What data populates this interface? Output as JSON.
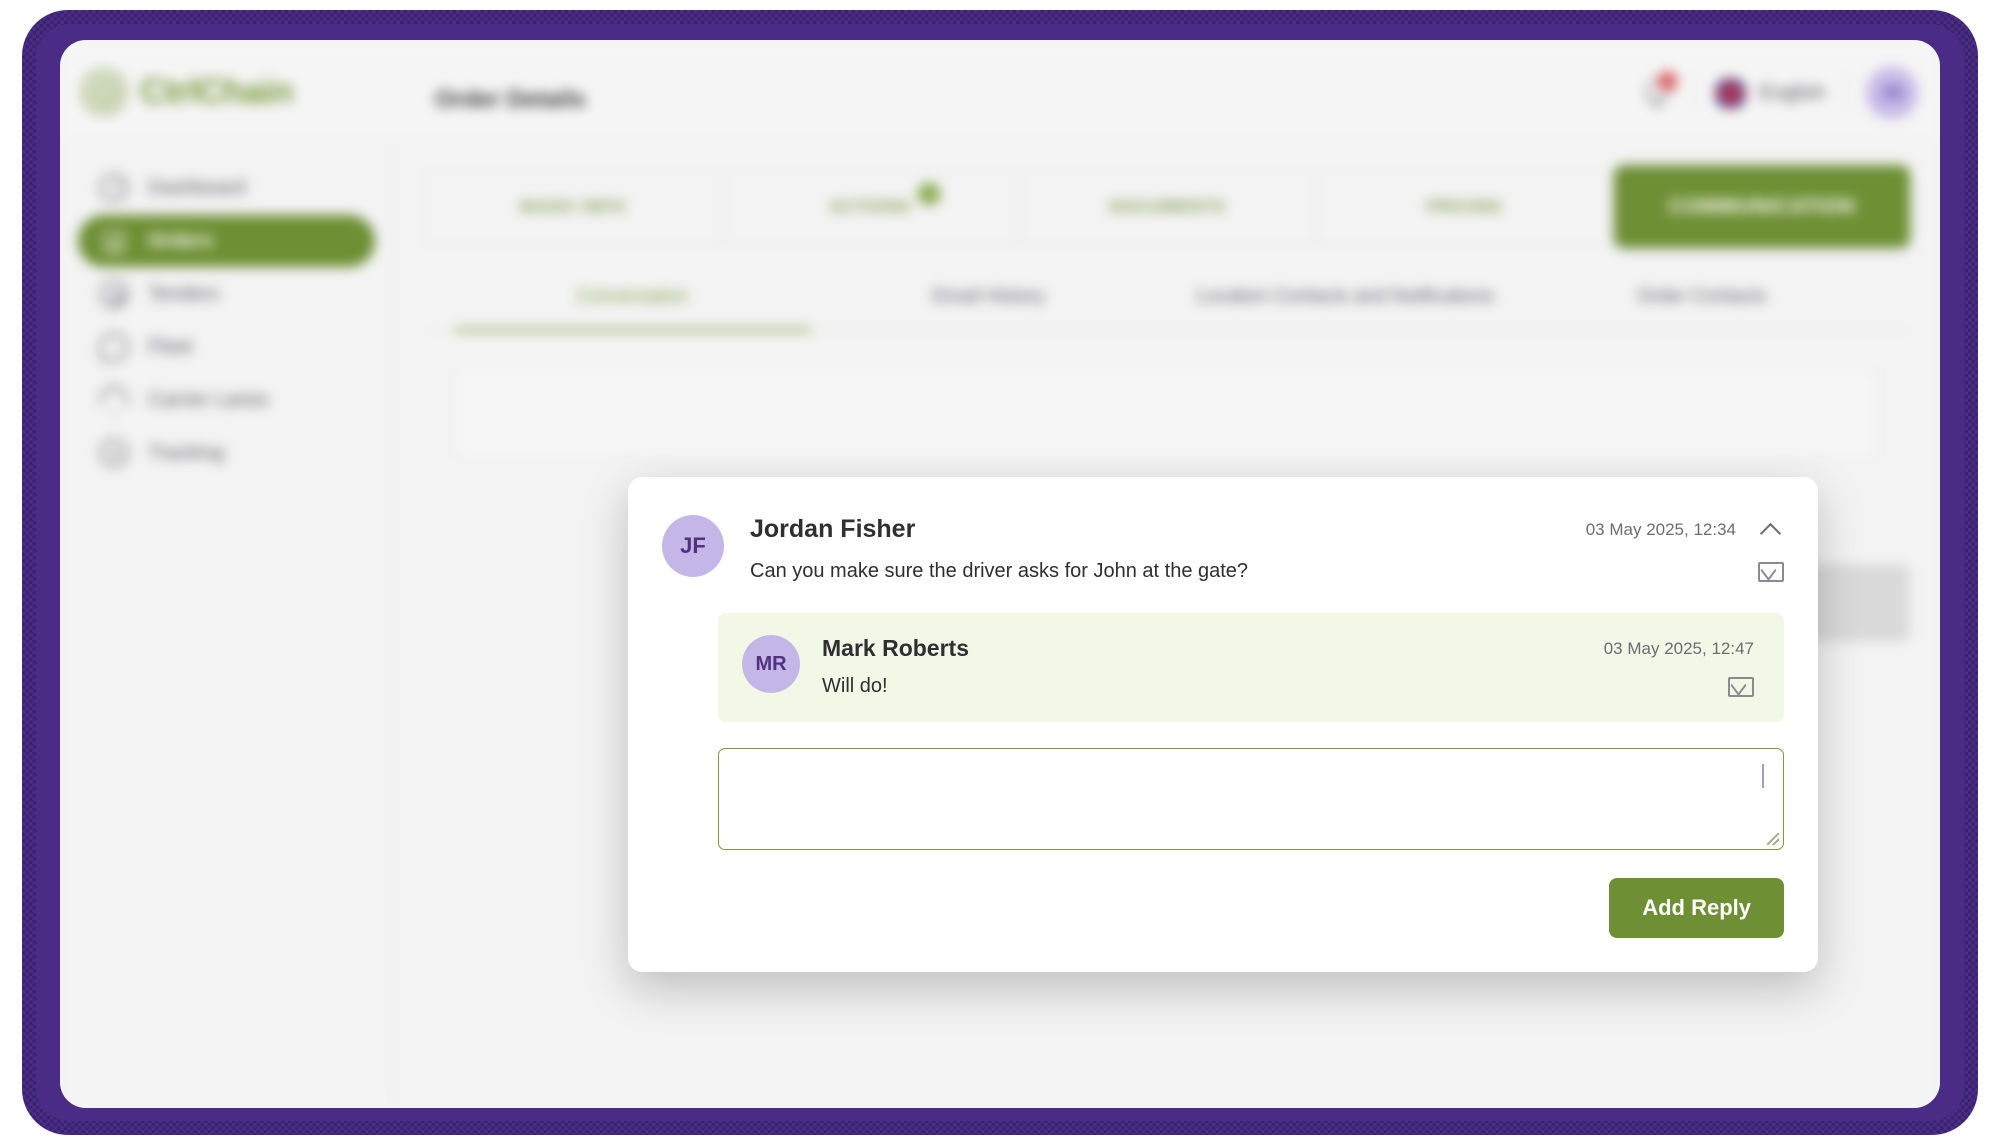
{
  "frame": {
    "border_color": "#4a2c87"
  },
  "brand": {
    "name": "CtrlChain",
    "color": "#7a9a3e",
    "logo_icon": "target-icon"
  },
  "header": {
    "page_title": "Order Details",
    "notifications": {
      "icon": "bell-icon",
      "badge_count": "1",
      "badge_color": "#d64545"
    },
    "language": {
      "icon": "uk-flag-icon",
      "label": "English"
    },
    "user_avatar": {
      "initials": "JS",
      "bg": "#c7bbe8"
    }
  },
  "sidebar": {
    "items": [
      {
        "label": "Dashboard",
        "icon": "gauge-icon",
        "active": false
      },
      {
        "label": "Orders",
        "icon": "clipboard-icon",
        "active": true
      },
      {
        "label": "Tenders",
        "icon": "gear-icon",
        "active": false
      },
      {
        "label": "Fleet",
        "icon": "truck-icon",
        "active": false
      },
      {
        "label": "Carrier Lanes",
        "icon": "pin-icon",
        "active": false
      },
      {
        "label": "Tracking",
        "icon": "target-icon",
        "active": false
      }
    ],
    "active_color": "#6e8f34"
  },
  "main": {
    "tabs": [
      {
        "label": "BASIC INFO",
        "active": false,
        "badge": ""
      },
      {
        "label": "ACTIONS",
        "active": false,
        "badge": "1"
      },
      {
        "label": "DOCUMENTS",
        "active": false,
        "badge": ""
      },
      {
        "label": "PRICING",
        "active": false,
        "badge": ""
      },
      {
        "label": "COMMUNICATION",
        "active": true,
        "badge": ""
      }
    ],
    "subtabs": [
      {
        "label": "Conversation",
        "active": true
      },
      {
        "label": "Email History",
        "active": false
      },
      {
        "label": "Location Contacts and Notifications",
        "active": false
      },
      {
        "label": "Order Contacts",
        "active": false
      }
    ]
  },
  "modal": {
    "message": {
      "avatar_initials": "JF",
      "author": "Jordan Fisher",
      "timestamp": "03 May 2025, 12:34",
      "text": "Can you make sure the driver asks for John at the gate?",
      "collapse_icon": "chevron-up-icon",
      "email_icon": "envelope-icon"
    },
    "reply": {
      "avatar_initials": "MR",
      "author": "Mark Roberts",
      "timestamp": "03 May 2025, 12:47",
      "text": "Will do!",
      "email_icon": "envelope-icon",
      "bg": "#f3f7e6"
    },
    "reply_input": {
      "value": "",
      "placeholder": ""
    },
    "submit_label": "Add Reply",
    "submit_color": "#6e8f34"
  }
}
